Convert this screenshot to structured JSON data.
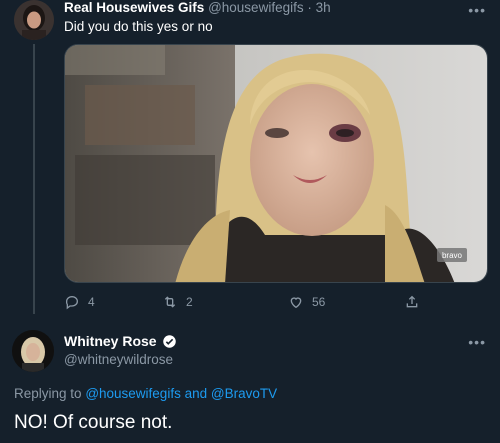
{
  "tweet": {
    "author_name": "Real Housewives Gifs",
    "author_handle": "@housewifegifs",
    "separator": "·",
    "time": "3h",
    "text": "Did you do this yes or no",
    "more_icon": "more-horizontal-icon",
    "media_badge": "bravo",
    "actions": {
      "reply_count": "4",
      "retweet_count": "2",
      "like_count": "56"
    }
  },
  "reply": {
    "author_name": "Whitney Rose",
    "author_handle": "@whitneywildrose",
    "replying_prefix": "Replying to",
    "mention1": "@housewifegifs",
    "and_word": "and",
    "mention2": "@BravoTV",
    "text": "NO! Of course not."
  },
  "colors": {
    "background": "#15202b",
    "secondary_text": "#8b98a5",
    "link": "#1d9bf0",
    "divider": "#38444d",
    "verified": "#1d9bf0"
  }
}
